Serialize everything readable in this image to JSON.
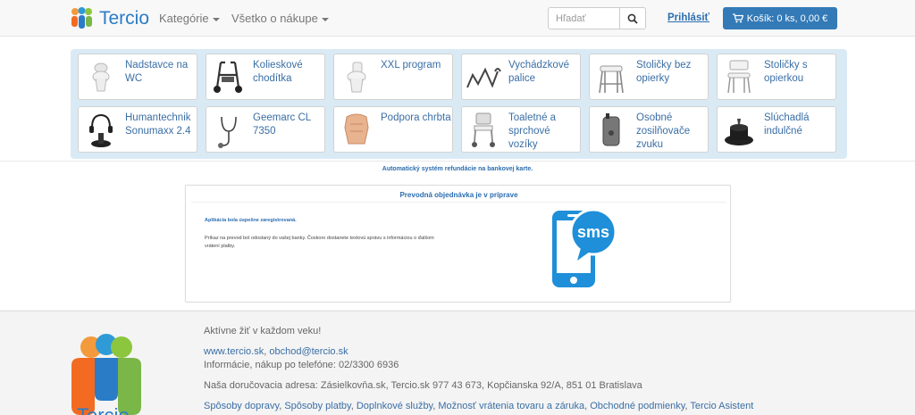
{
  "header": {
    "brand": "Tercio",
    "nav": [
      {
        "label": "Kategórie"
      },
      {
        "label": "Všetko o nákupe"
      }
    ],
    "search_placeholder": "Hľadať",
    "login_label": "Prihlásiť",
    "cart_label": "Košík: 0 ks, 0,00 €"
  },
  "categories": [
    {
      "label": "Nadstavce na WC",
      "icon": "toilet-seat-icon"
    },
    {
      "label": "Kolieskové chodítka",
      "icon": "rollator-icon"
    },
    {
      "label": "XXL program",
      "icon": "toilet-icon"
    },
    {
      "label": "Vychádzkové palice",
      "icon": "walking-cane-icon"
    },
    {
      "label": "Stoličky bez opierky",
      "icon": "shower-stool-icon"
    },
    {
      "label": "Stoličky s opierkou",
      "icon": "shower-chair-icon"
    },
    {
      "label": "Humantechnik Sonumaxx 2.4",
      "icon": "headphones-icon"
    },
    {
      "label": "Geemarc CL 7350",
      "icon": "stethoset-icon"
    },
    {
      "label": "Podpora chrbta",
      "icon": "back-support-icon"
    },
    {
      "label": "Toaletné a sprchové vozíky",
      "icon": "commode-chair-icon"
    },
    {
      "label": "Osobné zosilňovače zvuku",
      "icon": "sound-amplifier-icon"
    },
    {
      "label": "Slúchadlá indulčné",
      "icon": "induction-headset-icon"
    }
  ],
  "refund_note": "Automatický systém refundácie na bankovej karte.",
  "order_card": {
    "title": "Prevodná objednávka je v príprave",
    "success": "Aplikácia bola úspešne zaregistrovaná.",
    "text": "Príkaz na prevod bol odoslaný do vašej banky. Čoskoro dostanete textovú správu s informáciou o ďalšom vrátení platby.",
    "sms_badge": "sms"
  },
  "footer": {
    "brand": "Tercio",
    "tagline": "Aktívne žiť v každom veku!",
    "web": "www.tercio.sk",
    "email": "obchod@tercio.sk",
    "phone_info": "Informácie, nákup po telefóne: 02/3300 6936",
    "address": "Naša doručovacia adresa: Zásielkovňa.sk, Tercio.sk 977 43 673, Kopčianska 92/A, 851 01 Bratislava",
    "links": [
      "Spôsoby dopravy",
      "Spôsoby platby",
      "Doplnkové služby",
      "Možnosť vrátenia tovaru a záruka",
      "Obchodné podmienky",
      "Tercio Asistent"
    ]
  },
  "colors": {
    "accent": "#337ab7",
    "link": "#3a6ea5",
    "grid_bg": "#d9eaf5",
    "sms_blue": "#1e8fd8"
  }
}
